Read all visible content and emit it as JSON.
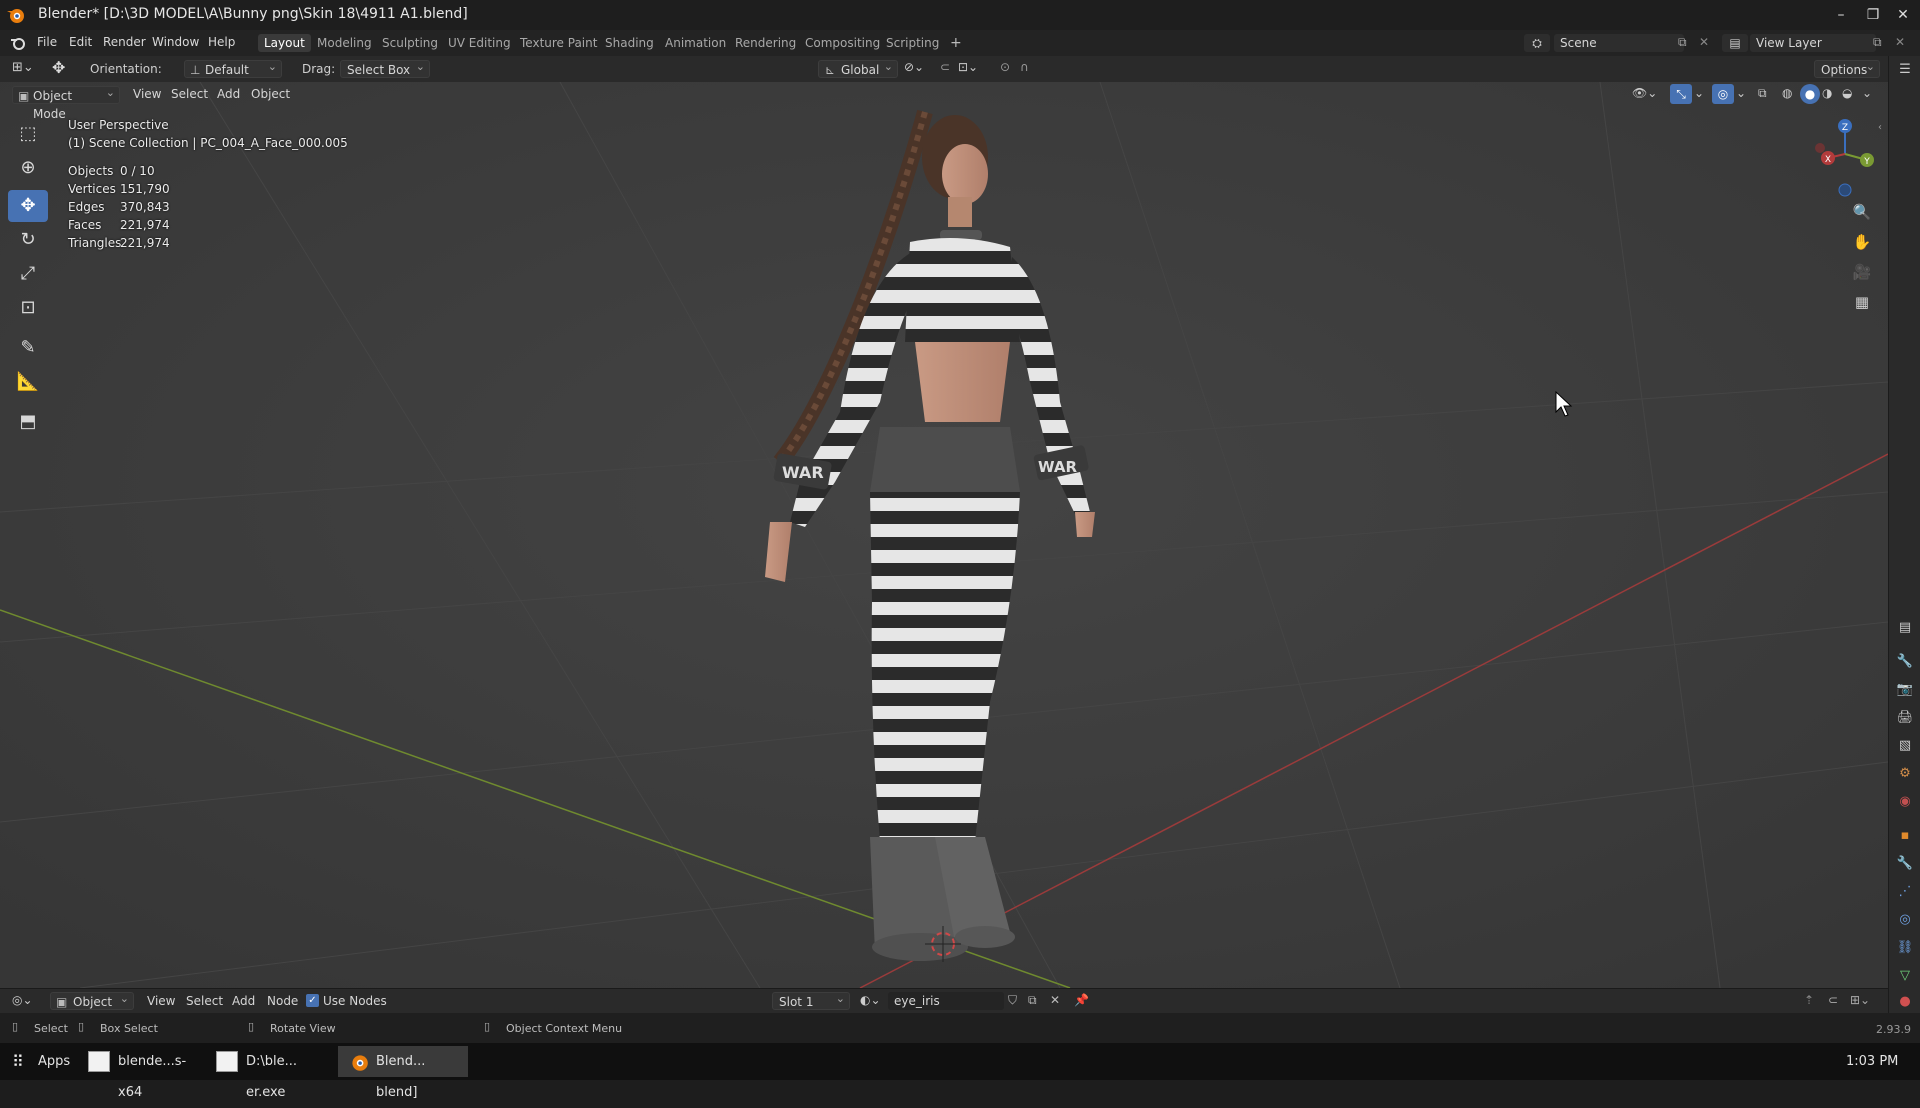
{
  "window": {
    "title": "Blender* [D:\\3D MODEL\\A\\Bunny png\\Skin 18\\4911 A1.blend]"
  },
  "menu": {
    "items": [
      "File",
      "Edit",
      "Render",
      "Window",
      "Help"
    ]
  },
  "workspaces": {
    "tabs": [
      "Layout",
      "Modeling",
      "Sculpting",
      "UV Editing",
      "Texture Paint",
      "Shading",
      "Animation",
      "Rendering",
      "Compositing",
      "Scripting"
    ],
    "active": "Layout",
    "add_symbol": "+"
  },
  "scene": {
    "name": "Scene",
    "view_layer": "View Layer"
  },
  "tool_header": {
    "orientation_label": "Orientation:",
    "orientation_value": "Default",
    "drag_label": "Drag:",
    "drag_value": "Select Box",
    "transform_orientation": "Global",
    "options_label": "Options"
  },
  "viewport_header": {
    "mode": "Object Mode",
    "menus": [
      "View",
      "Select",
      "Add",
      "Object"
    ]
  },
  "viewport_overlay": {
    "perspective": "User Perspective",
    "collection": "(1) Scene Collection | PC_004_A_Face_000.005",
    "stats": [
      {
        "label": "Objects",
        "value": "0 / 10"
      },
      {
        "label": "Vertices",
        "value": "151,790"
      },
      {
        "label": "Edges",
        "value": "370,843"
      },
      {
        "label": "Faces",
        "value": "221,974"
      },
      {
        "label": "Triangles",
        "value": "221,974"
      }
    ]
  },
  "gizmo": {
    "x": "X",
    "y": "Y",
    "z": "Z"
  },
  "model": {
    "sleeve_text": "WAR"
  },
  "colors": {
    "accent": "#4772b3",
    "axis_x": "#b23b3b",
    "axis_y": "#7a9a33",
    "axis_z": "#3a6fbf",
    "viewport_bg": "#3d3d3d"
  },
  "editor_header": {
    "editor_type": "Object",
    "menus": [
      "View",
      "Select",
      "Add",
      "Node"
    ],
    "use_nodes_label": "Use Nodes",
    "use_nodes_checked": true,
    "slot": "Slot 1",
    "material": "eye_iris"
  },
  "status_bar": {
    "select": "Select",
    "box_select": "Box Select",
    "rotate_view": "Rotate View",
    "context_menu": "Object Context Menu",
    "version": "2.93.9"
  },
  "taskbar": {
    "apps_label": "Apps",
    "items": [
      "blende...s-x64",
      "D:\\ble... er.exe",
      "Blend... blend]"
    ],
    "clock": "1:03 PM"
  }
}
